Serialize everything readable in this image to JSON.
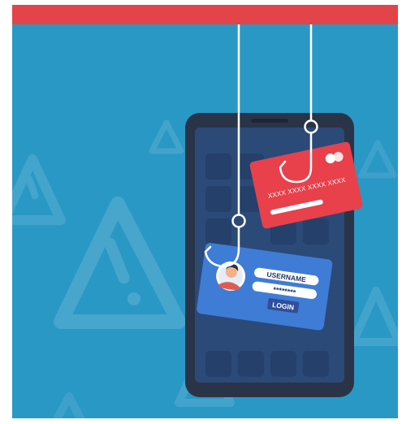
{
  "colors": {
    "background": "#2a98c5",
    "top_bar": "#e34449",
    "phone_body": "#2a3448",
    "phone_screen": "#2b4a78",
    "credit_card": "#e8414b",
    "id_card": "#3f7cd6",
    "login_button": "#2f4f9c"
  },
  "credit_card": {
    "number": "XXXX XXXX XXXX XXXX"
  },
  "id_card": {
    "username_label": "USERNAME",
    "password_mask": "********",
    "login_label": "LOGIN"
  },
  "icons": [
    "warning-triangle-icon",
    "fishing-hook-icon",
    "user-avatar-icon",
    "card-chip-logo-icon"
  ]
}
